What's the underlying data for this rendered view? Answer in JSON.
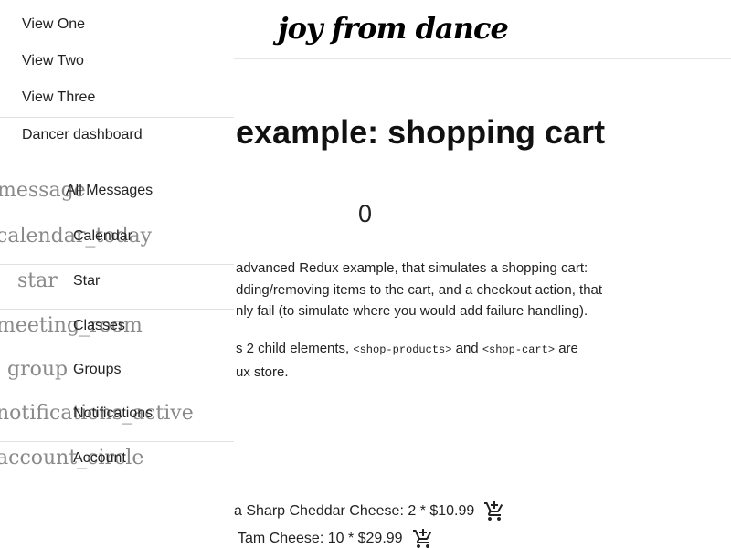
{
  "brand": {
    "title": "joy from dance"
  },
  "drawer": {
    "views": [
      "View One",
      "View Two",
      "View Three",
      "Dancer dashboard"
    ],
    "menu": [
      {
        "icon": "message",
        "label": "All Messages"
      },
      {
        "icon": "calendar_today",
        "label": "Calendar"
      },
      {
        "icon": "star",
        "label": "Star"
      },
      {
        "icon": "meeting_room",
        "label": "Classes"
      },
      {
        "icon": "group",
        "label": "Groups"
      },
      {
        "icon": "notifications_active",
        "label": "Notifications"
      },
      {
        "icon": "account_circle",
        "label": "Account"
      }
    ]
  },
  "main": {
    "title": "example: shopping cart",
    "counter": "0",
    "paragraph1": {
      "line1": "advanced Redux example, that simulates a shopping cart:",
      "line2": "dding/removing items to the cart, and a checkout action, that",
      "line3": "nly fail (to simulate where you would add failure handling)."
    },
    "paragraph2": {
      "line1_start": "s 2 child elements, ",
      "code1": "<shop-products>",
      "mid": " and ",
      "code2": "<shop-cart>",
      "line1_end": " are",
      "line2": "ux store."
    },
    "products": [
      {
        "text": "a Sharp Cheddar Cheese: 2 * $10.99",
        "button_icon": "add-shopping-cart-icon"
      },
      {
        "text": "Tam Cheese: 10 * $29.99",
        "button_icon": "add-shopping-cart-icon"
      }
    ]
  },
  "colors": {
    "icon_ligature": "#8a8a8a",
    "divider": "#e0e0e0",
    "text": "#222222"
  }
}
